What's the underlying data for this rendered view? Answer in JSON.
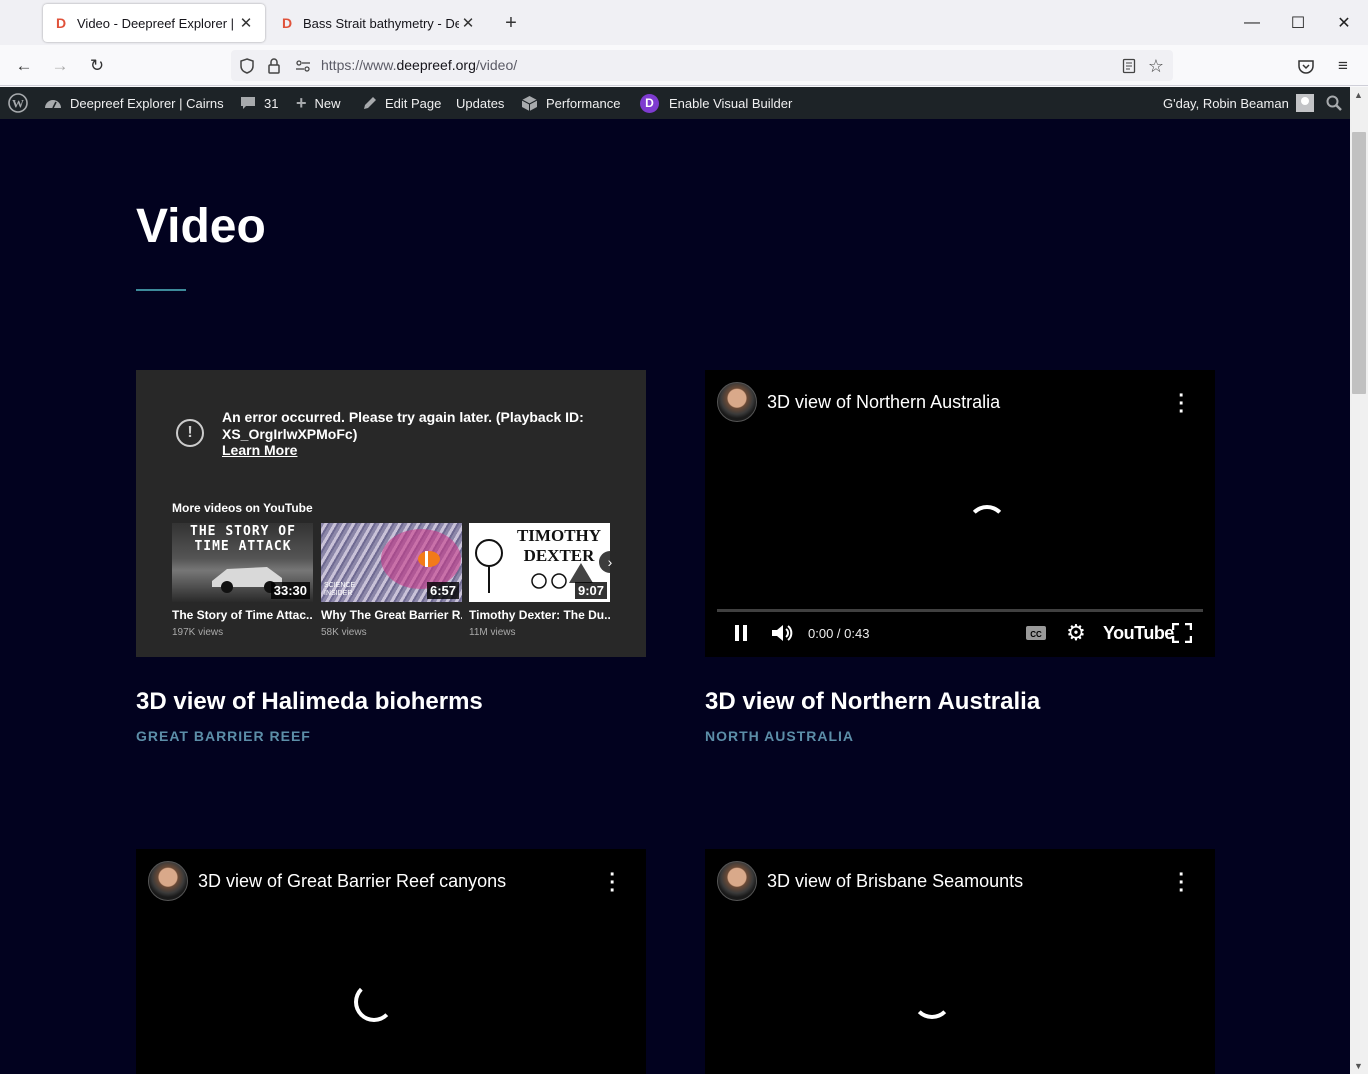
{
  "browser": {
    "tabs": [
      {
        "title": "Video - Deepreef Explorer | Cairns",
        "favicon": "D",
        "active": true
      },
      {
        "title": "Bass Strait bathymetry - Deepreef Explorer",
        "favicon": "D",
        "active": false
      }
    ],
    "url_prefix": "https://www.",
    "url_domain": "deepreef.org",
    "url_path": "/video/"
  },
  "adminbar": {
    "site_name": "Deepreef Explorer | Cairns",
    "comments_count": "31",
    "new_label": "New",
    "edit_label": "Edit Page",
    "updates_label": "Updates",
    "performance_label": "Performance",
    "divi_badge": "D",
    "visual_builder_label": "Enable Visual Builder",
    "greeting": "G'day, Robin Beaman"
  },
  "page": {
    "title": "Video"
  },
  "videos": [
    {
      "state": "error",
      "error_message": "An error occurred. Please try again later. (Playback ID: XS_OrgIrlwXPMoFc)",
      "learn_more": "Learn More",
      "more_label": "More videos on YouTube",
      "suggestions": [
        {
          "thumb_text": "THE STORY OF TIME ATTACK",
          "duration": "33:30",
          "title": "The Story of Time Attac...",
          "views": "197K views"
        },
        {
          "thumb_text": "SCIENCE INSIDER",
          "duration": "6:57",
          "title": "Why The Great Barrier R...",
          "views": "58K views"
        },
        {
          "thumb_text": "TIMOTHY DEXTER",
          "duration": "9:07",
          "title": "Timothy Dexter: The Du...",
          "views": "11M views"
        }
      ],
      "card_title": "3D view of Halimeda bioherms",
      "category": "GREAT BARRIER REEF"
    },
    {
      "state": "playing",
      "player_title": "3D view of Northern Australia",
      "time": "0:00 / 0:43",
      "youtube_label": "YouTube",
      "card_title": "3D view of Northern Australia",
      "category": "NORTH AUSTRALIA"
    },
    {
      "state": "loading",
      "player_title": "3D view of Great Barrier Reef canyons"
    },
    {
      "state": "loading",
      "player_title": "3D view of Brisbane Seamounts"
    }
  ],
  "colors": {
    "page_bg": "#02021f",
    "accent_rule": "#3d8a9a",
    "category": "#5c8ea8",
    "divi_purple": "#7e3bd0"
  }
}
